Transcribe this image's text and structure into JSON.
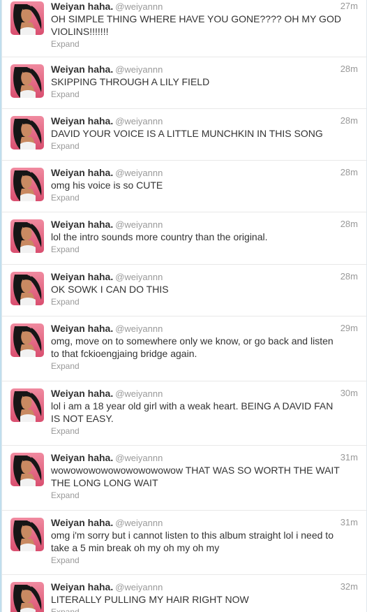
{
  "colors": {
    "text": "#333333",
    "meta": "#999999",
    "divider": "#e8e8e8",
    "avatar_bg": "#e8607a",
    "avatar_hair": "#161616",
    "avatar_skin": "#c98a62"
  },
  "icons": {
    "avatar": "profile-photo-pocahontas"
  },
  "tweets": [
    {
      "fullname": "Weiyan haha.",
      "username": "@weiyannn",
      "time": "27m",
      "text": "OH SIMPLE THING WHERE HAVE YOU GONE???? OH MY GOD VIOLINS!!!!!!!",
      "expand": "Expand"
    },
    {
      "fullname": "Weiyan haha.",
      "username": "@weiyannn",
      "time": "28m",
      "text": "SKIPPING THROUGH A LILY FIELD",
      "expand": "Expand"
    },
    {
      "fullname": "Weiyan haha.",
      "username": "@weiyannn",
      "time": "28m",
      "text": "DAVID YOUR VOICE IS A LITTLE MUNCHKIN IN THIS SONG",
      "expand": "Expand"
    },
    {
      "fullname": "Weiyan haha.",
      "username": "@weiyannn",
      "time": "28m",
      "text": "omg his voice is so CUTE",
      "expand": "Expand"
    },
    {
      "fullname": "Weiyan haha.",
      "username": "@weiyannn",
      "time": "28m",
      "text": "lol the intro sounds more country than the original.",
      "expand": "Expand"
    },
    {
      "fullname": "Weiyan haha.",
      "username": "@weiyannn",
      "time": "28m",
      "text": "OK SOWK I CAN DO THIS",
      "expand": "Expand"
    },
    {
      "fullname": "Weiyan haha.",
      "username": "@weiyannn",
      "time": "29m",
      "text": "omg, move on to somewhere only we know, or go back and listen to that fckioengjaing bridge again.",
      "expand": "Expand"
    },
    {
      "fullname": "Weiyan haha.",
      "username": "@weiyannn",
      "time": "30m",
      "text": "lol i am a 18 year old girl with a weak heart. BEING A DAVID FAN IS NOT EASY.",
      "expand": "Expand"
    },
    {
      "fullname": "Weiyan haha.",
      "username": "@weiyannn",
      "time": "31m",
      "text": "wowowowowowowowowowow THAT WAS SO WORTH THE WAIT THE LONG LONG WAIT",
      "expand": "Expand"
    },
    {
      "fullname": "Weiyan haha.",
      "username": "@weiyannn",
      "time": "31m",
      "text": "omg i'm sorry but i cannot listen to this album straight lol i need to take a 5 min break oh my oh my oh my",
      "expand": "Expand"
    },
    {
      "fullname": "Weiyan haha.",
      "username": "@weiyannn",
      "time": "32m",
      "text": "LITERALLY PULLING MY HAIR RIGHT NOW",
      "expand": "Expand"
    }
  ]
}
